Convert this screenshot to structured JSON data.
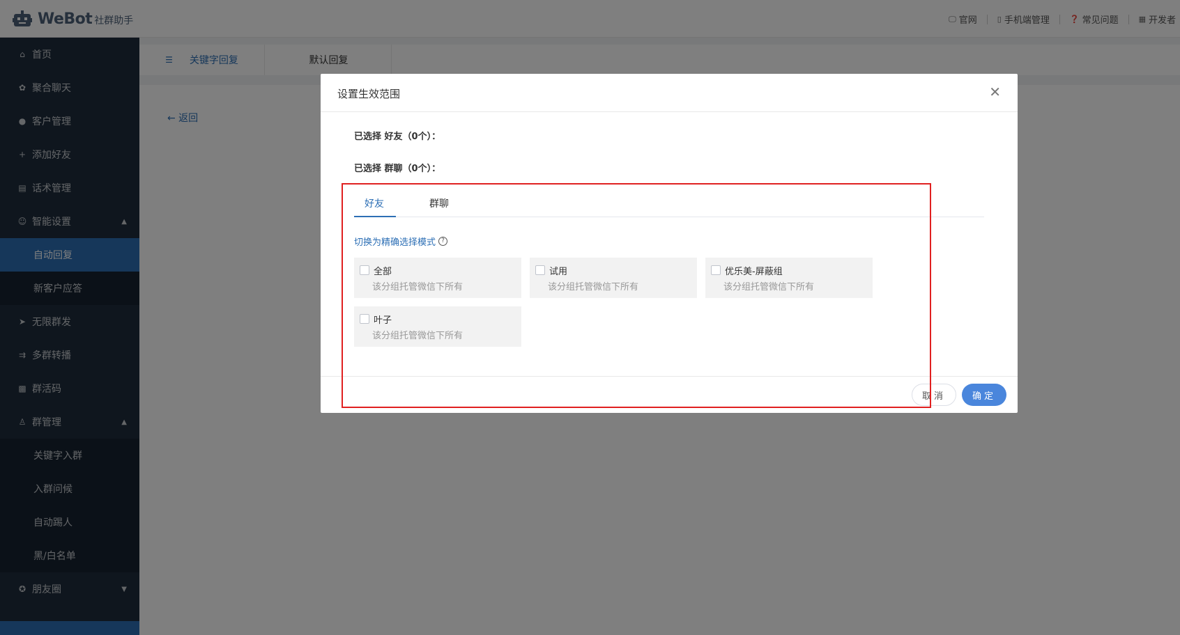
{
  "app": {
    "logo_text": "WeBot",
    "logo_sub": "社群助手"
  },
  "topnav": [
    {
      "label": "官网",
      "icon": "monitor-icon"
    },
    {
      "label": "手机端管理",
      "icon": "phone-icon"
    },
    {
      "label": "常见问题",
      "icon": "question-icon"
    },
    {
      "label": "开发者",
      "icon": "developer-icon"
    }
  ],
  "sidebar": {
    "items": [
      {
        "label": "首页",
        "icon": "home-icon"
      },
      {
        "label": "聚合聊天",
        "icon": "gear-icon"
      },
      {
        "label": "客户管理",
        "icon": "user-icon"
      },
      {
        "label": "添加好友",
        "icon": "add-user-icon"
      },
      {
        "label": "话术管理",
        "icon": "document-icon"
      },
      {
        "label": "智能设置",
        "icon": "smart-icon"
      },
      {
        "label": "无限群发",
        "icon": "send-icon"
      },
      {
        "label": "多群转播",
        "icon": "broadcast-icon"
      },
      {
        "label": "群活码",
        "icon": "qrcode-icon"
      },
      {
        "label": "群管理",
        "icon": "group-icon"
      },
      {
        "label": "朋友圈",
        "icon": "moments-icon"
      }
    ],
    "smart_sub": [
      {
        "label": "自动回复"
      },
      {
        "label": "新客户应答"
      }
    ],
    "group_sub": [
      {
        "label": "关键字入群"
      },
      {
        "label": "入群问候"
      },
      {
        "label": "自动踢人"
      },
      {
        "label": "黑/白名单"
      }
    ]
  },
  "page_tabs": [
    {
      "label": "关键字回复"
    },
    {
      "label": "默认回复"
    }
  ],
  "back_label": "← 返回",
  "dialog": {
    "title": "设置生效范围",
    "close_glyph": "✕",
    "selected_friends": "已选择 好友（0个）：",
    "selected_groups": "已选择 群聊（0个）：",
    "tabs": [
      {
        "label": "好友"
      },
      {
        "label": "群聊"
      }
    ],
    "switch_mode": "切换为精确选择模式",
    "groups": [
      {
        "name": "全部",
        "desc": "该分组托管微信下所有"
      },
      {
        "name": "试用",
        "desc": "该分组托管微信下所有"
      },
      {
        "name": "优乐美-屏蔽组",
        "desc": "该分组托管微信下所有"
      },
      {
        "name": "叶子",
        "desc": "该分组托管微信下所有"
      }
    ],
    "cancel_label": "取消",
    "ok_label": "确定"
  },
  "colors": {
    "sidebar_bg": "#1f2d3d",
    "accent": "#2d6fb5",
    "primary_button": "#4a86dc",
    "annotation": "#e02020"
  }
}
